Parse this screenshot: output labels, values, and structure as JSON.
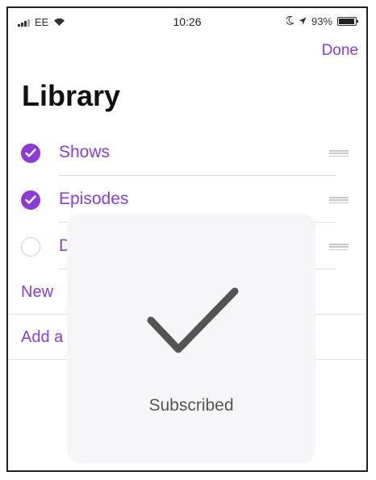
{
  "status_bar": {
    "carrier": "EE",
    "time": "10:26",
    "battery": "93%",
    "battery_level": 0.93
  },
  "nav": {
    "done_label": "Done"
  },
  "page": {
    "title": "Library"
  },
  "list": {
    "items": [
      {
        "label": "Shows",
        "checked": true
      },
      {
        "label": "Episodes",
        "checked": true
      },
      {
        "label": "D",
        "checked": false
      }
    ]
  },
  "actions": {
    "new_label": "New",
    "add_label": "Add a"
  },
  "hud": {
    "label": "Subscribed",
    "icon": "checkmark-icon"
  },
  "colors": {
    "accent": "#8a3bd9",
    "hud_background": "#f6f6f8",
    "hud_text": "#555555"
  }
}
